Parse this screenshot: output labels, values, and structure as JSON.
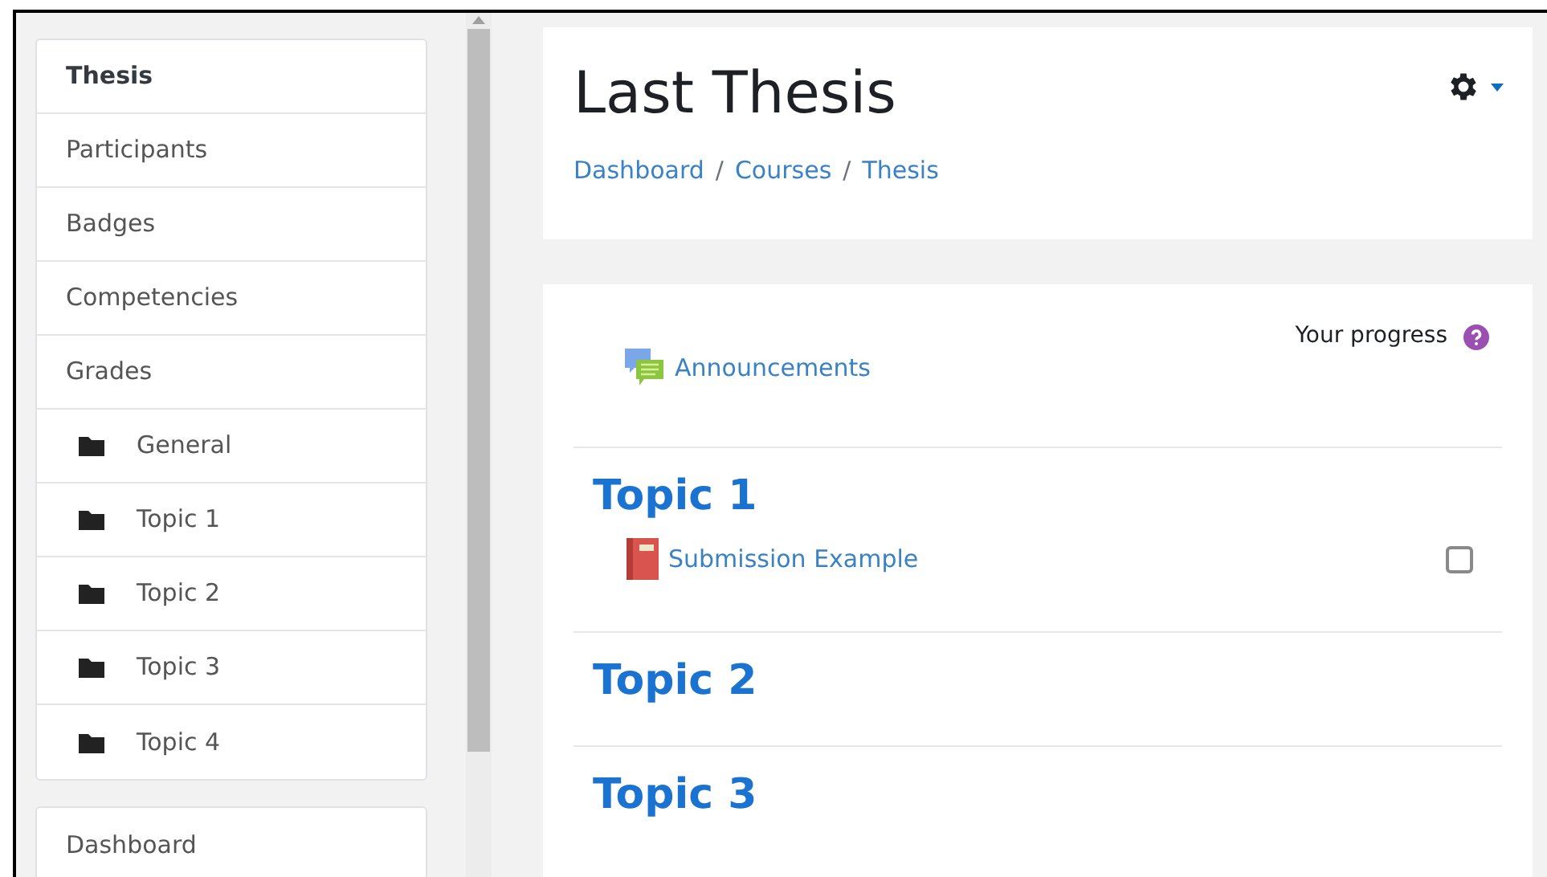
{
  "nav": [
    {
      "label": "Thesis",
      "selected": true
    },
    {
      "label": "Participants",
      "selected": false
    },
    {
      "label": "Badges",
      "selected": false
    },
    {
      "label": "Competencies",
      "selected": false
    },
    {
      "label": "Grades",
      "selected": false,
      "children": [
        {
          "label": "General",
          "selected": false
        },
        {
          "label": "Topic 1",
          "selected": false
        },
        {
          "label": "Topic 2",
          "selected": false
        },
        {
          "label": "Topic 3",
          "selected": false
        },
        {
          "label": "Topic 4",
          "selected": false
        }
      ]
    }
  ],
  "nav2": [
    {
      "label": "Dashboard",
      "selected": false
    }
  ],
  "header": {
    "title": "Last Thesis",
    "breadcrumb": [
      "Dashboard",
      "Courses",
      "Thesis"
    ],
    "separator": "/"
  },
  "progress_label": "Your progress",
  "general_activities": [
    {
      "kind": "forum",
      "label": "Announcements"
    }
  ],
  "sections": [
    {
      "title": "Topic 1",
      "activities": [
        {
          "kind": "assignment",
          "label": "Submission Example",
          "checked": false
        }
      ]
    },
    {
      "title": "Topic 2"
    },
    {
      "title": "Topic 3"
    }
  ]
}
